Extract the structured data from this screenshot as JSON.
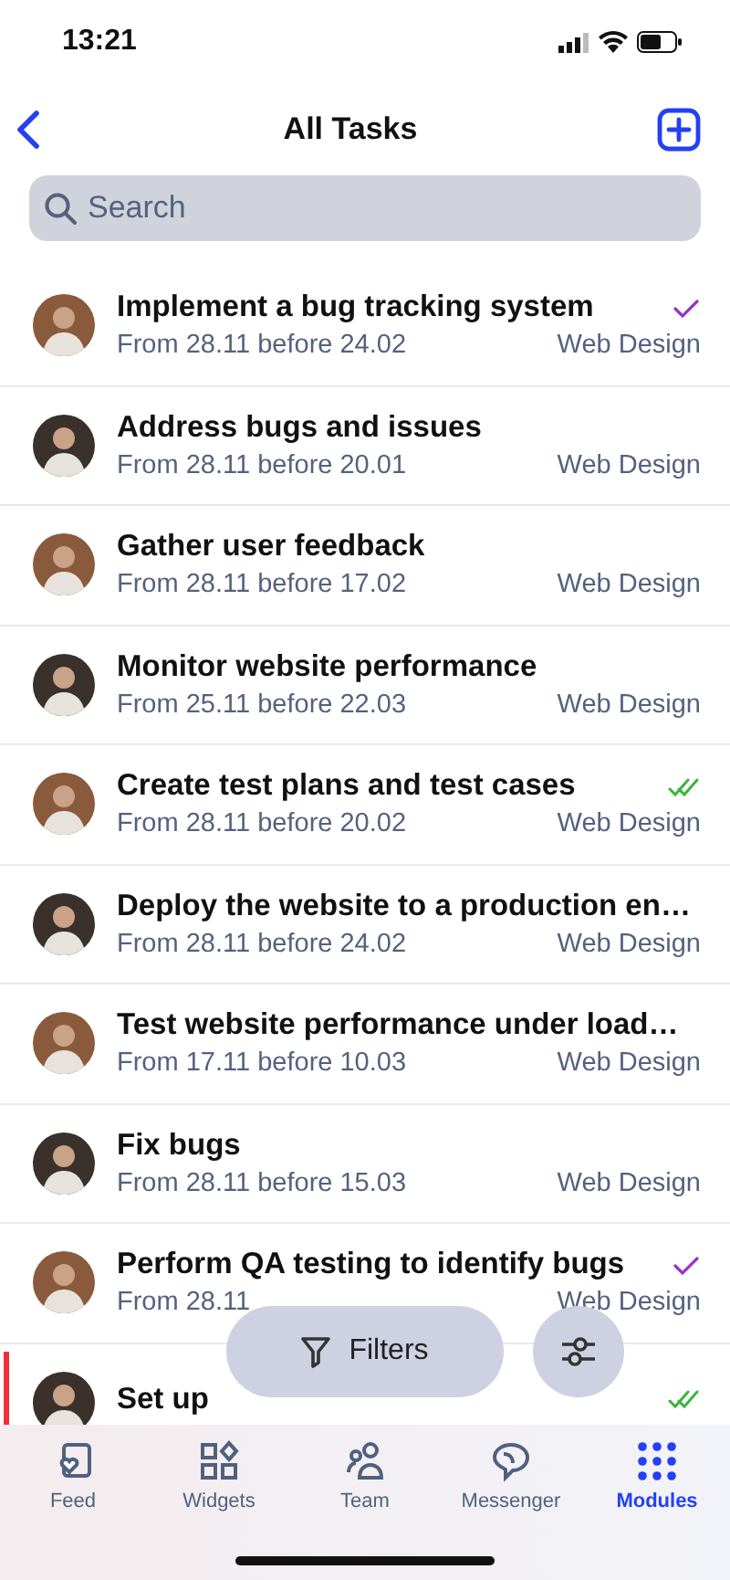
{
  "status_bar": {
    "time": "13:21"
  },
  "nav": {
    "title": "All Tasks"
  },
  "search": {
    "placeholder": "Search"
  },
  "tasks": [
    {
      "title": "Implement a bug tracking system",
      "dates": "From 28.11 before 24.02",
      "project": "Web Design",
      "kind": "checked",
      "overdue": false
    },
    {
      "title": "Address bugs and issues",
      "dates": "From 28.11 before 20.01",
      "project": "Web Design",
      "kind": "plain",
      "overdue": false
    },
    {
      "title": "Gather user feedback",
      "dates": "From 28.11 before 17.02",
      "project": "Web Design",
      "kind": "plain",
      "overdue": false
    },
    {
      "title": "Monitor website performance",
      "dates": "From 25.11 before 22.03",
      "project": "Web Design",
      "kind": "plain",
      "overdue": false
    },
    {
      "title": "Create test plans and test cases",
      "dates": "From 28.11 before 20.02",
      "project": "Web Design",
      "kind": "double-checked",
      "overdue": false
    },
    {
      "title": "Deploy the website to a production en…",
      "dates": "From 28.11 before 24.02",
      "project": "Web Design",
      "kind": "plain",
      "overdue": false
    },
    {
      "title": "Test website performance under load…",
      "dates": "From 17.11 before 10.03",
      "project": "Web Design",
      "kind": "plain",
      "overdue": false
    },
    {
      "title": "Fix bugs",
      "dates": "From 28.11 before 15.03",
      "project": "Web Design",
      "kind": "plain",
      "overdue": false
    },
    {
      "title": "Perform QA testing to identify bugs",
      "dates": "From 28.11",
      "project": "Web Design",
      "kind": "checked",
      "overdue": false
    },
    {
      "title": "Set up",
      "kind": "double-checked",
      "overdue": true
    }
  ],
  "filters": {
    "label": "Filters"
  },
  "tab_bar": [
    {
      "label": "Feed",
      "kind": "feed",
      "selected": false
    },
    {
      "label": "Widgets",
      "kind": "widgets",
      "selected": false
    },
    {
      "label": "Team",
      "kind": "team",
      "selected": false
    },
    {
      "label": "Messenger",
      "kind": "messenger",
      "selected": false
    },
    {
      "label": "Modules",
      "kind": "modules",
      "selected": true
    }
  ]
}
